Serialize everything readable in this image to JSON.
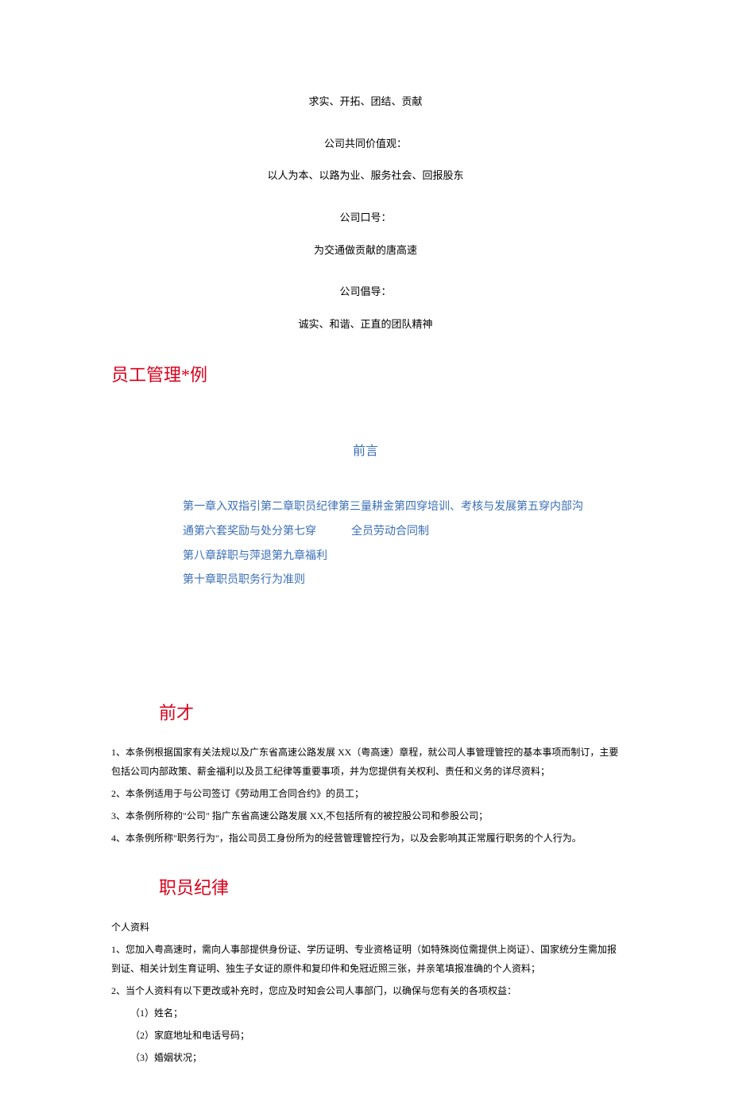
{
  "header": {
    "spirit": "求实、开拓、团结、贡献",
    "values_label": "公司共同价值观：",
    "values_text": "以人为本、以路为业、服务社会、回报股东",
    "slogan_label": "公司口号：",
    "slogan_text": "为交通做贡献的唐高速",
    "advocate_label": "公司倡导：",
    "advocate_text": "诚实、和谐、正直的团队精神"
  },
  "title_main": "员工管理*例",
  "preface": {
    "title": "前言"
  },
  "toc": {
    "line1": "第一章入双指引第二章职员纪律第三量耕金第四穿培训、考核与发展第五穿内部沟",
    "line2a": "通第六套奖励与处分第七穿",
    "line2b": "全员劳动合同制",
    "line3": "第八章辞职与萍退第九章福利",
    "line4": "第十章职员职务行为准则"
  },
  "section_preface_heading": "前才",
  "preface_items": {
    "p1": "1、本条例根据国家有关法规以及广东省高速公路发展 XX（粤高速）章程，就公司人事管理管控的基本事项而制订，主要包括公司内部政策、薪金福利以及员工纪律等重要事项，并为您提供有关权利、责任和义务的详尽资料；",
    "p2": "2、本条例适用于与公司签订《劳动用工合同合约》的员工；",
    "p3": "3、本条例所称的\"公司\" 指广东省高速公路发展 XX,不包括所有的被控股公司和参股公司；",
    "p4": "4、本条例所称\"职务行为\"，指公司员工身份所为的经营管理管控行为，以及会影响其正常履行职务的个人行为。"
  },
  "section_discipline_heading": "职员纪律",
  "discipline": {
    "sublabel": "个人资料",
    "p1": "1、您加入粤高速时，需向人事部提供身份证、学历证明、专业资格证明（如特殊岗位需提供上岗证）、国家统分生需加报到证、相关计划生育证明、独生子女证的原件和复印件和免冠近照三张，并亲笔填报准确的个人资料；",
    "p2": "2、当个人资料有以下更改或补充时，您应及时知会公司人事部门，以确保与您有关的各项权益：",
    "i1": "（1）姓名；",
    "i2": "（2）家庭地址和电话号码；",
    "i3": "（3）婚姻状况；"
  }
}
